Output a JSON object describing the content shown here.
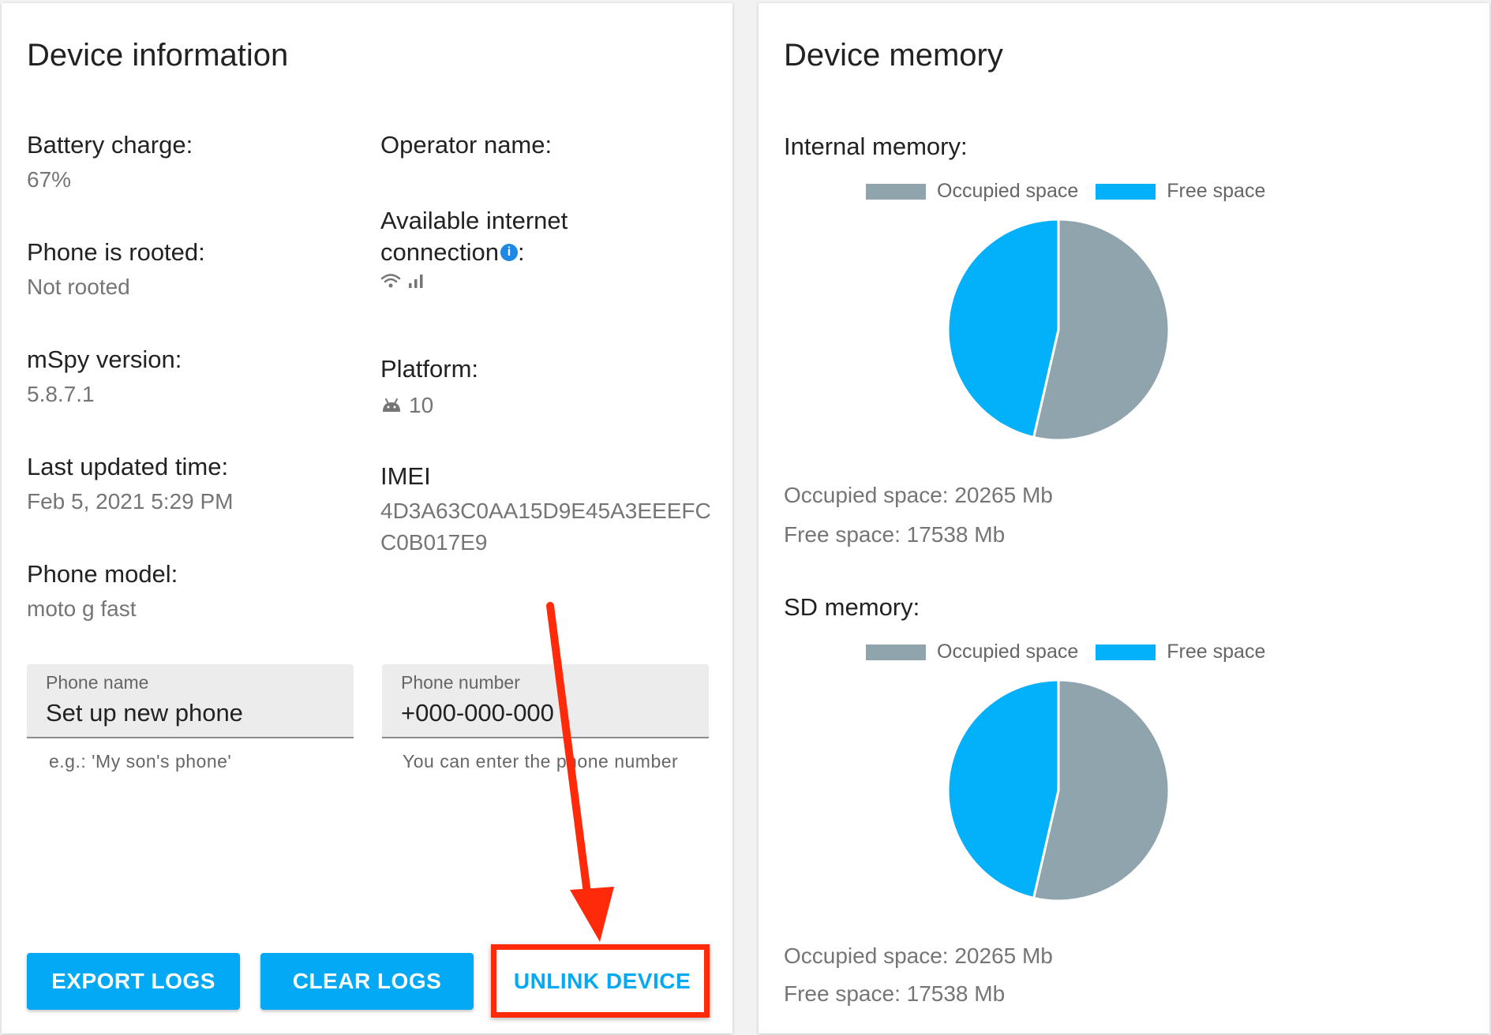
{
  "device_info": {
    "title": "Device information",
    "battery": {
      "label": "Battery charge:",
      "value": "67%"
    },
    "rooted": {
      "label": "Phone is rooted:",
      "value": "Not rooted"
    },
    "version": {
      "label": "mSpy version:",
      "value": "5.8.7.1"
    },
    "last_updated": {
      "label": "Last updated time:",
      "value": "Feb 5, 2021 5:29 PM"
    },
    "model": {
      "label": "Phone model:",
      "value": "moto g fast"
    },
    "operator": {
      "label": "Operator name:",
      "value": ""
    },
    "connection": {
      "label_line1": "Available internet",
      "label_line2": "connection",
      "label_suffix": ":",
      "info_glyph": "i",
      "icons": [
        "wifi-icon",
        "cellular-signal-icon"
      ]
    },
    "platform": {
      "label": "Platform:",
      "value": "10",
      "icon": "android-icon"
    },
    "imei": {
      "label": "IMEI",
      "value": "4D3A63C0AA15D9E45A3EEEFCC0B017E9"
    },
    "phone_name_input": {
      "label": "Phone name",
      "value": "Set up new phone",
      "helper": "e.g.: 'My son's phone'"
    },
    "phone_number_input": {
      "label": "Phone number",
      "value": "+000-000-000",
      "helper": "You can enter the phone number"
    },
    "buttons": {
      "export": "EXPORT LOGS",
      "clear": "CLEAR LOGS",
      "unlink": "UNLINK DEVICE"
    },
    "colors": {
      "accent": "#03a9f4",
      "annotation": "#ff2a0a"
    }
  },
  "device_memory": {
    "title": "Device memory",
    "internal": {
      "label": "Internal memory:",
      "legend": [
        "Occupied space",
        "Free space"
      ],
      "occupied_text": "Occupied space: 20265 Mb",
      "free_text": "Free space: 17538 Mb"
    },
    "sd": {
      "label": "SD memory:",
      "legend": [
        "Occupied space",
        "Free space"
      ],
      "occupied_text": "Occupied space: 20265 Mb",
      "free_text": "Free space: 17538 Mb"
    },
    "colors": {
      "occupied": "#90a4ae",
      "free": "#03b0fa"
    }
  },
  "chart_data": [
    {
      "type": "pie",
      "categories": [
        "Occupied space",
        "Free space"
      ],
      "values": [
        20265,
        17538
      ],
      "legend": "top"
    },
    {
      "type": "pie",
      "categories": [
        "Occupied space",
        "Free space"
      ],
      "values": [
        20265,
        17538
      ],
      "legend": "top"
    }
  ]
}
